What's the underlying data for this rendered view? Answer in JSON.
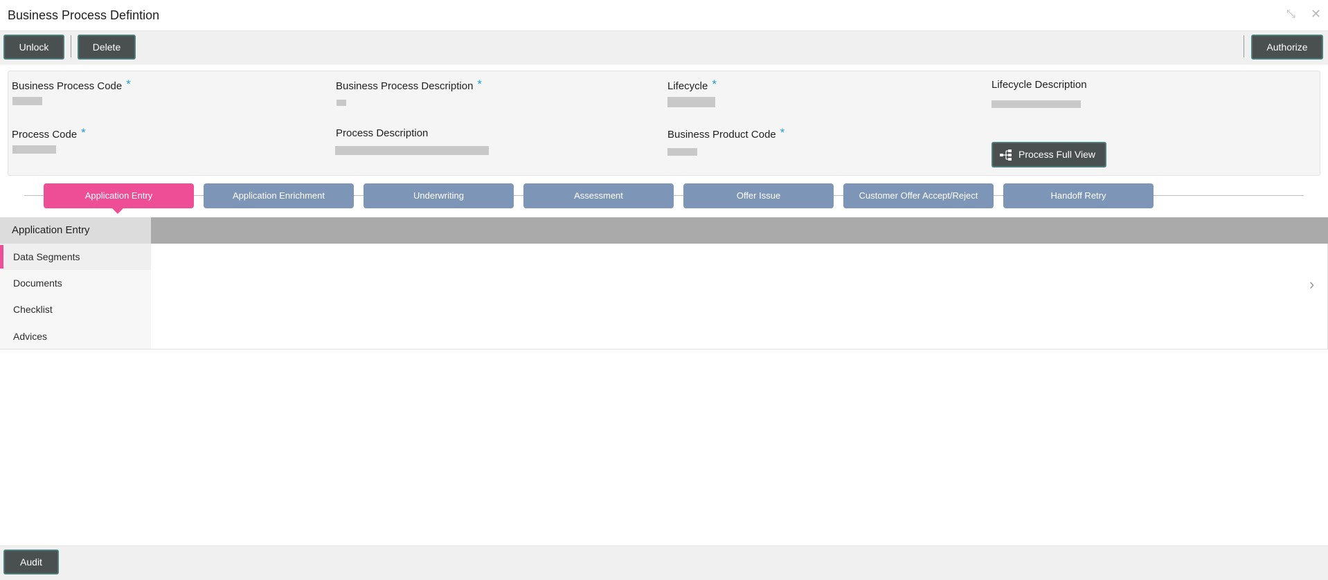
{
  "window": {
    "title": "Business Process Defintion",
    "icons": [
      "collapse-icon",
      "close-icon"
    ]
  },
  "toolbar": {
    "unlock_label": "Unlock",
    "delete_label": "Delete",
    "authorize_label": "Authorize"
  },
  "fields": {
    "business_process_code_label": "Business Process Code",
    "business_process_description_label": "Business Process Description",
    "lifecycle_label": "Lifecycle",
    "lifecycle_description_label": "Lifecycle Description",
    "process_code_label": "Process Code",
    "process_description_label": "Process Description",
    "business_product_code_label": "Business Product Code",
    "required_mark": "*"
  },
  "process_full_view": {
    "label": "Process Full View",
    "icon": "hierarchy-icon"
  },
  "stages": [
    {
      "label": "Application Entry",
      "active": true
    },
    {
      "label": "Application Enrichment",
      "active": false
    },
    {
      "label": "Underwriting",
      "active": false
    },
    {
      "label": "Assessment",
      "active": false
    },
    {
      "label": "Offer Issue",
      "active": false
    },
    {
      "label": "Customer Offer Accept/Reject",
      "active": false
    },
    {
      "label": "Handoff Retry",
      "active": false
    }
  ],
  "section": {
    "title": "Application Entry",
    "items": [
      {
        "label": "Data Segments",
        "active": true
      },
      {
        "label": "Documents",
        "active": false
      },
      {
        "label": "Checklist",
        "active": false
      },
      {
        "label": "Advices",
        "active": false
      }
    ],
    "next_icon": "chevron-right-icon"
  },
  "footer": {
    "audit_label": "Audit"
  },
  "colors": {
    "accent_pink": "#ee4e96",
    "stage_inactive": "#7d96b8",
    "button_dark": "#4a4f4f",
    "required_blue": "#1c9fd6"
  }
}
